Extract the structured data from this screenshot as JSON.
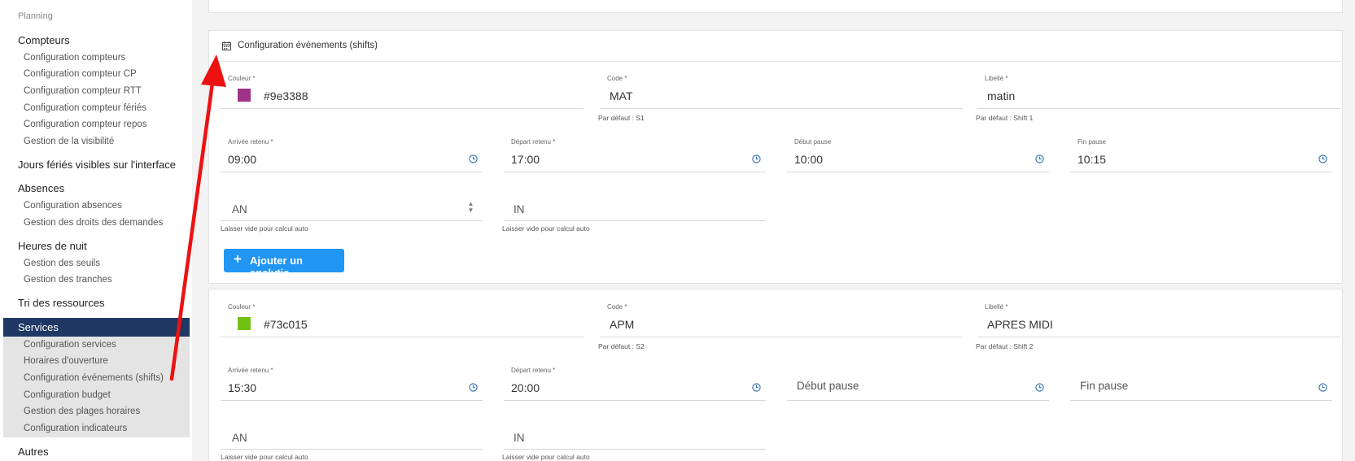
{
  "sidebar": {
    "top_item": "Planning",
    "sections": [
      {
        "label": "Compteurs",
        "items": [
          "Configuration compteurs",
          "Configuration compteur CP",
          "Configuration compteur RTT",
          "Configuration compteur fériés",
          "Configuration compteur repos",
          "Gestion de la visibilité"
        ]
      },
      {
        "label": "Jours fériés visibles sur l'interface",
        "items": []
      },
      {
        "label": "Absences",
        "items": [
          "Configuration absences",
          "Gestion des droits des demandes"
        ]
      },
      {
        "label": "Heures de nuit",
        "items": [
          "Gestion des seuils",
          "Gestion des tranches"
        ]
      },
      {
        "label": "Tri des ressources",
        "items": []
      },
      {
        "label": "Services",
        "active": true,
        "items": [
          "Configuration services",
          "Horaires d'ouverture",
          "Configuration événements (shifts)",
          "Configuration budget",
          "Gestion des plages horaires",
          "Configuration indicateurs"
        ]
      },
      {
        "label": "Autres",
        "items": []
      }
    ]
  },
  "card": {
    "title": "Configuration événements (shifts)",
    "add_button": "Ajouter un analytic"
  },
  "labels": {
    "color": "Couleur *",
    "code": "Code *",
    "libelle": "Libellé *",
    "arrival": "Arrivée retenu *",
    "departure": "Départ retenu *",
    "pause_start": "Début pause",
    "pause_end": "Fin pause",
    "auto_hint": "Laisser vide pour calcul auto"
  },
  "shifts": [
    {
      "color": "#9e3388",
      "code": "MAT",
      "code_default": "Par défaut : S1",
      "libelle": "matin",
      "libelle_default": "Par défaut : Shift 1",
      "arrival": "09:00",
      "departure": "17:00",
      "pause_start": "10:00",
      "pause_end": "10:15",
      "an": "AN",
      "in": "IN"
    },
    {
      "color": "#73c015",
      "code": "APM",
      "code_default": "Par défaut : S2",
      "libelle": "APRES MIDI",
      "libelle_default": "Par défaut : Shift 2",
      "arrival": "15:30",
      "departure": "20:00",
      "pause_start": "",
      "pause_end": "",
      "an": "AN",
      "in": "IN"
    }
  ],
  "colors": {
    "sidebar_active": "#1f3864",
    "button": "#2196f3",
    "annotation_arrow": "#ee1111"
  }
}
